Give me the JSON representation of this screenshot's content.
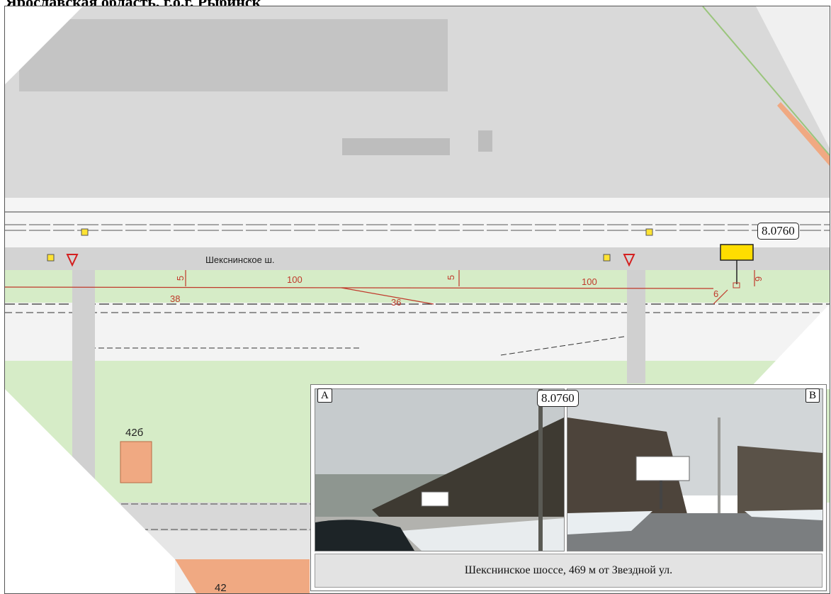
{
  "header": {
    "title": "Ярославская область, г.о.г. Рыбинск"
  },
  "map": {
    "street_name": "Шекснинское ш.",
    "distance_left": "100",
    "distance_right": "100",
    "dim_5_left": "5",
    "dim_5_mid": "5",
    "dim_6_right": "6",
    "dim_6_sign": "6",
    "dim_38": "38",
    "dim_36": "36",
    "plot_42b": "42б",
    "plot_42": "42",
    "sign_code": "8.0760"
  },
  "panel": {
    "tag_a": "A",
    "tag_b": "B",
    "photo_code": "8.0760",
    "caption": "Шекснинское шоссе, 469 м от Звездной ул."
  },
  "colors": {
    "green_zone": "#d6ecc7",
    "sign_yellow": "#ffdd00",
    "plot_orange": "#f0a982",
    "dimension_red": "#c0392b"
  }
}
